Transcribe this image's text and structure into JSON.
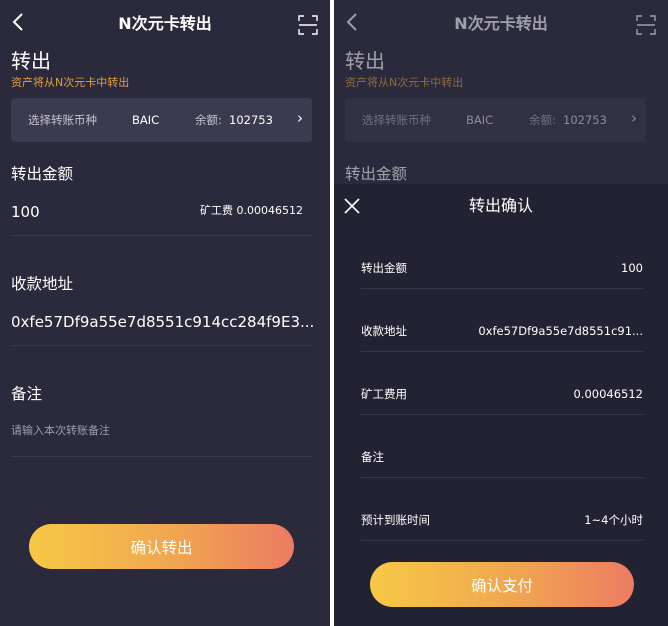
{
  "screen1": {
    "title": "N次元卡转出",
    "heading": "转出",
    "subtitle": "资产将从N次元卡中转出",
    "selector": {
      "label": "选择转账币种",
      "coin": "BAIC",
      "balance_label": "余额:",
      "balance": "102753",
      "chevron": "›"
    },
    "amount_label": "转出金额",
    "amount_value": "100",
    "fee_label": "矿工费",
    "fee_value": "0.00046512",
    "address_label": "收款地址",
    "address_value": "0xfe57Df9a55e7d8551c914cc284f9E3...",
    "memo_label": "备注",
    "memo_placeholder": "请输入本次转账备注",
    "confirm_button": "确认转出"
  },
  "screen2": {
    "title": "N次元卡转出",
    "heading": "转出",
    "subtitle": "资产将从N次元卡中转出",
    "selector": {
      "label": "选择转账币种",
      "coin": "BAIC",
      "balance_label": "余额:",
      "balance": "102753",
      "chevron": "›"
    },
    "amount_label": "转出金额",
    "sheet": {
      "title": "转出确认",
      "rows": [
        {
          "key": "转出金额",
          "value": "100"
        },
        {
          "key": "收款地址",
          "value": "0xfe57Df9a55e7d8551c91..."
        },
        {
          "key": "矿工费用",
          "value": "0.00046512"
        },
        {
          "key": "备注",
          "value": ""
        },
        {
          "key": "预计到账时间",
          "value": "1~4个小时"
        }
      ],
      "pay_button": "确认支付"
    }
  },
  "icons": {
    "back": "chevron-left-icon",
    "scan": "scan-icon",
    "close": "close-icon"
  },
  "colors": {
    "background": "#2b2a3c",
    "sheet": "#232232",
    "accent_orange": "#e0a13b",
    "button_gradient_start": "#f6c845",
    "button_gradient_end": "#ec7b62"
  }
}
